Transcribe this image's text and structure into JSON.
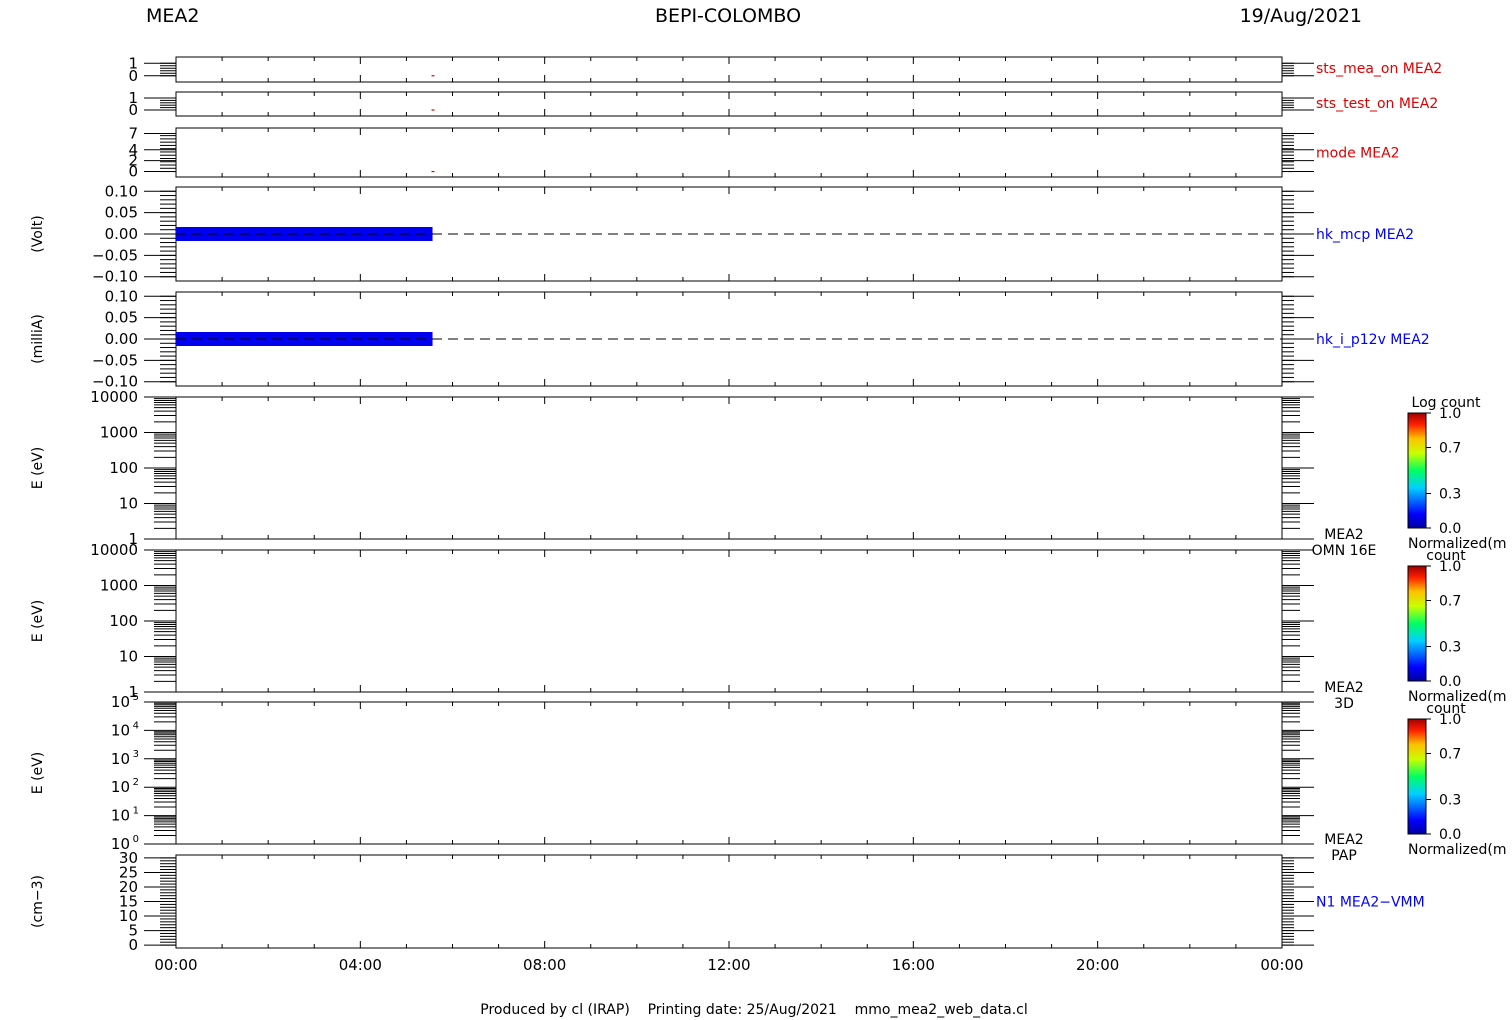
{
  "header": {
    "left": "MEA2",
    "center": "BEPI-COLOMBO",
    "right": "19/Aug/2021"
  },
  "footer": "Produced by cl (IRAP)    Printing date: 25/Aug/2021    mmo_mea2_web_data.cl",
  "colors": {
    "red": "#e00000",
    "blue": "#0000ff",
    "bar_blue": "#0000ee",
    "black": "#000000"
  },
  "chart_data": [
    {
      "type": "line",
      "name": "sts_mea_on MEA2",
      "label_color": "#e00000",
      "yticks": [
        "1",
        "0"
      ],
      "ylim": [
        -0.5,
        1.5
      ],
      "x_time_range": [
        "19/Aug/2021 00:00",
        "20/Aug/2021 00:00"
      ],
      "points": [
        {
          "x": "05:34",
          "y": 0
        }
      ]
    },
    {
      "type": "line",
      "name": "sts_test_on MEA2",
      "label_color": "#e00000",
      "yticks": [
        "1",
        "0"
      ],
      "ylim": [
        -0.5,
        1.5
      ],
      "points": [
        {
          "x": "05:34",
          "y": 0
        }
      ]
    },
    {
      "type": "line",
      "name": "mode MEA2",
      "label_color": "#e00000",
      "yticks": [
        "7",
        "4",
        "2",
        "0"
      ],
      "ylim": [
        -1,
        8
      ],
      "points": [
        {
          "x": "05:34",
          "y": 0
        }
      ]
    },
    {
      "type": "bar",
      "name": "hk_mcp MEA2",
      "ylabel": "(Volt)",
      "label_color": "#0000ff",
      "yticks": [
        "0.10",
        "0.05",
        "0.00",
        "−0.05",
        "−0.10"
      ],
      "ylim": [
        -0.11,
        0.11
      ],
      "filled_interval": [
        "00:00",
        "05:34"
      ],
      "value": 0.0,
      "dashed_zero_line": true
    },
    {
      "type": "bar",
      "name": "hk_i_p12v MEA2",
      "ylabel": "(milliA)",
      "label_color": "#0000ff",
      "yticks": [
        "0.10",
        "0.05",
        "0.00",
        "−0.05",
        "−0.10"
      ],
      "ylim": [
        -0.11,
        0.11
      ],
      "filled_interval": [
        "00:00",
        "05:34"
      ],
      "value": 0.0,
      "dashed_zero_line": true
    },
    {
      "type": "heatmap",
      "ylabel": "E (eV)",
      "yscale": "log",
      "yticks": [
        "10000",
        "1000",
        "100",
        "10",
        "1"
      ],
      "ylim": [
        1,
        10000
      ],
      "side_label": [
        "MEA2",
        "OMN 16E"
      ],
      "colorbar": {
        "title": "Log count",
        "ticks": [
          "1.0",
          "0.7",
          "0.3",
          "0.0"
        ],
        "bottom_label": "Normalized(m"
      }
    },
    {
      "type": "heatmap",
      "ylabel": "E (eV)",
      "yscale": "log",
      "yticks": [
        "10000",
        "1000",
        "100",
        "10",
        "1"
      ],
      "ylim": [
        1,
        10000
      ],
      "side_label": [
        "MEA2",
        "3D"
      ],
      "colorbar": {
        "title": "count",
        "ticks": [
          "1.0",
          "0.7",
          "0.3",
          "0.0"
        ],
        "bottom_label": "Normalized(m"
      }
    },
    {
      "type": "heatmap",
      "ylabel": "E (eV)",
      "yscale": "log",
      "yticks": [
        {
          "base": "10",
          "exp": "5"
        },
        {
          "base": "10",
          "exp": "4"
        },
        {
          "base": "10",
          "exp": "3"
        },
        {
          "base": "10",
          "exp": "2"
        },
        {
          "base": "10",
          "exp": "1"
        },
        {
          "base": "10",
          "exp": "0"
        }
      ],
      "ylim": [
        1,
        100000
      ],
      "side_label": [
        "MEA2",
        "PAP"
      ],
      "colorbar": {
        "title": "count",
        "ticks": [
          "1.0",
          "0.7",
          "0.3",
          "0.0"
        ],
        "bottom_label": "Normalized(m"
      }
    },
    {
      "type": "line",
      "name": "N1 MEA2−VMM",
      "ylabel": "(cm−3)",
      "label_color": "#0000ff",
      "yticks": [
        "30",
        "25",
        "20",
        "15",
        "10",
        "5",
        "0"
      ],
      "ylim": [
        -1,
        31
      ],
      "points": []
    }
  ],
  "x_axis": {
    "tick_labels": [
      "00:00",
      "04:00",
      "08:00",
      "12:00",
      "16:00",
      "20:00",
      "00:00"
    ],
    "range_hours": [
      0,
      24
    ]
  }
}
